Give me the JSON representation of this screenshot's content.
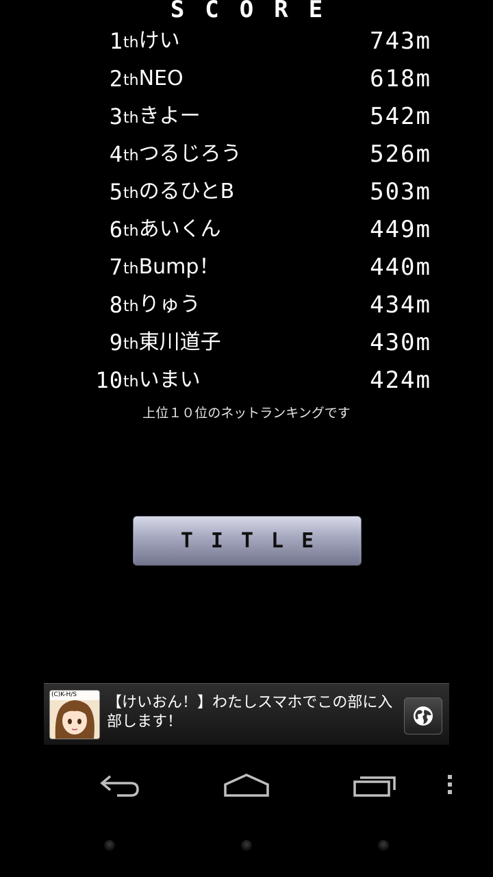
{
  "header": {
    "title": "SCORE"
  },
  "ranking": [
    {
      "ord": "1",
      "suffix": "th",
      "name": "けい",
      "score": "743m"
    },
    {
      "ord": "2",
      "suffix": "th",
      "name": "NEO",
      "score": "618m"
    },
    {
      "ord": "3",
      "suffix": "th",
      "name": "きよー",
      "score": "542m"
    },
    {
      "ord": "4",
      "suffix": "th",
      "name": "つるじろう",
      "score": "526m"
    },
    {
      "ord": "5",
      "suffix": "th",
      "name": "のるひとB",
      "score": "503m"
    },
    {
      "ord": "6",
      "suffix": "th",
      "name": "あいくん",
      "score": "449m"
    },
    {
      "ord": "7",
      "suffix": "th",
      "name": "Bump！",
      "score": "440m"
    },
    {
      "ord": "8",
      "suffix": "th",
      "name": "りゅう",
      "score": "434m"
    },
    {
      "ord": "9",
      "suffix": "th",
      "name": "東川道子",
      "score": "430m"
    },
    {
      "ord": "10",
      "suffix": "th",
      "name": "いまい",
      "score": "424m"
    }
  ],
  "note": "上位１０位のネットランキングです",
  "buttons": {
    "title_label": "TITLE"
  },
  "ad": {
    "thumb_tag": "(C)K-H/S",
    "text": "【けいおん！】わたしスマホでこの部に入部します！",
    "icon": "globe-icon"
  },
  "nav": {
    "back_icon": "back-icon",
    "home_icon": "home-icon",
    "recents_icon": "recent-apps-icon",
    "menu_icon": "overflow-menu-icon"
  }
}
